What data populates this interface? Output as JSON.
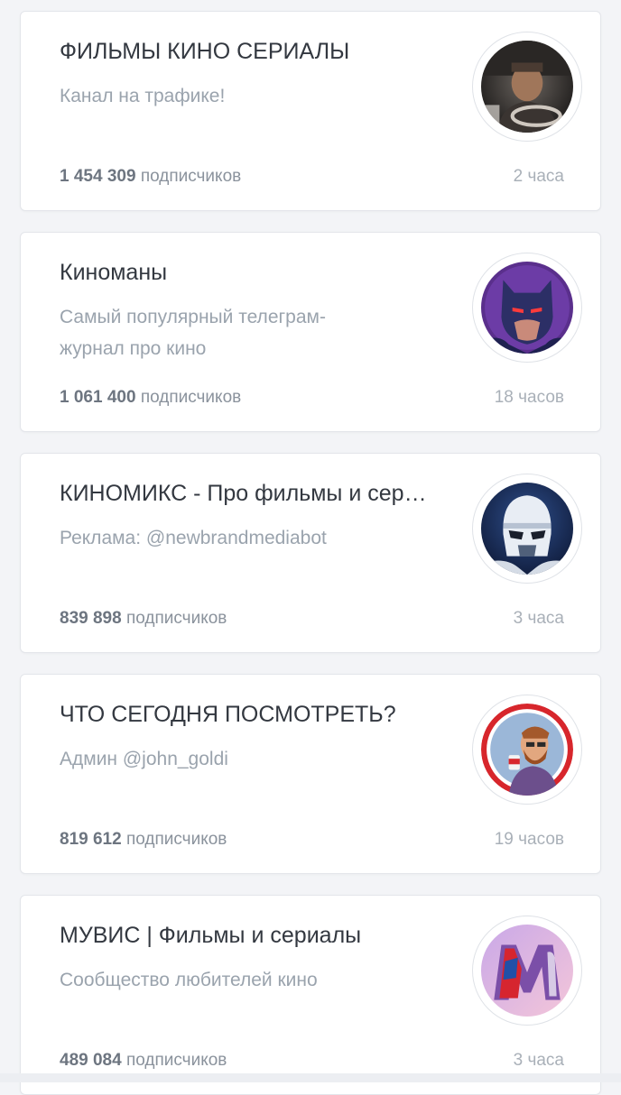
{
  "channels": [
    {
      "title": "ФИЛЬМЫ КИНО СЕРИАЛЫ",
      "description": "Канал на трафике!",
      "subscribers": "1 454 309",
      "subscribers_label": "подписчиков",
      "time": "2 часа",
      "avatar_icon": "car-driver-avatar-icon"
    },
    {
      "title": "Киноманы",
      "description": "Самый популярный телеграм-журнал про кино",
      "subscribers": "1 061 400",
      "subscribers_label": "подписчиков",
      "time": "18 часов",
      "avatar_icon": "batman-avatar-icon"
    },
    {
      "title": "КИНОМИКС - Про фильмы и сериалы",
      "description": "Реклама: @newbrandmediabot",
      "subscribers": "839 898",
      "subscribers_label": "подписчиков",
      "time": "3 часа",
      "avatar_icon": "stormtrooper-avatar-icon"
    },
    {
      "title": "ЧТО СЕГОДНЯ ПОСМОТРЕТЬ?",
      "description": "Админ @john_goldi",
      "subscribers": "819 612",
      "subscribers_label": "подписчиков",
      "time": "19 часов",
      "avatar_icon": "bearded-man-avatar-icon"
    },
    {
      "title": "МУВИС | Фильмы и сериалы",
      "description": "Сообщество любителей кино",
      "subscribers": "489 084",
      "subscribers_label": "подписчиков",
      "time": "3 часа",
      "avatar_icon": "spiderman-m-logo-avatar-icon"
    }
  ],
  "colors": {
    "page_background": "#f3f4f7",
    "card_background": "#ffffff",
    "title": "#333840",
    "description": "#9aa3ad",
    "count": "#6d7580",
    "time": "#a9b0b8"
  }
}
